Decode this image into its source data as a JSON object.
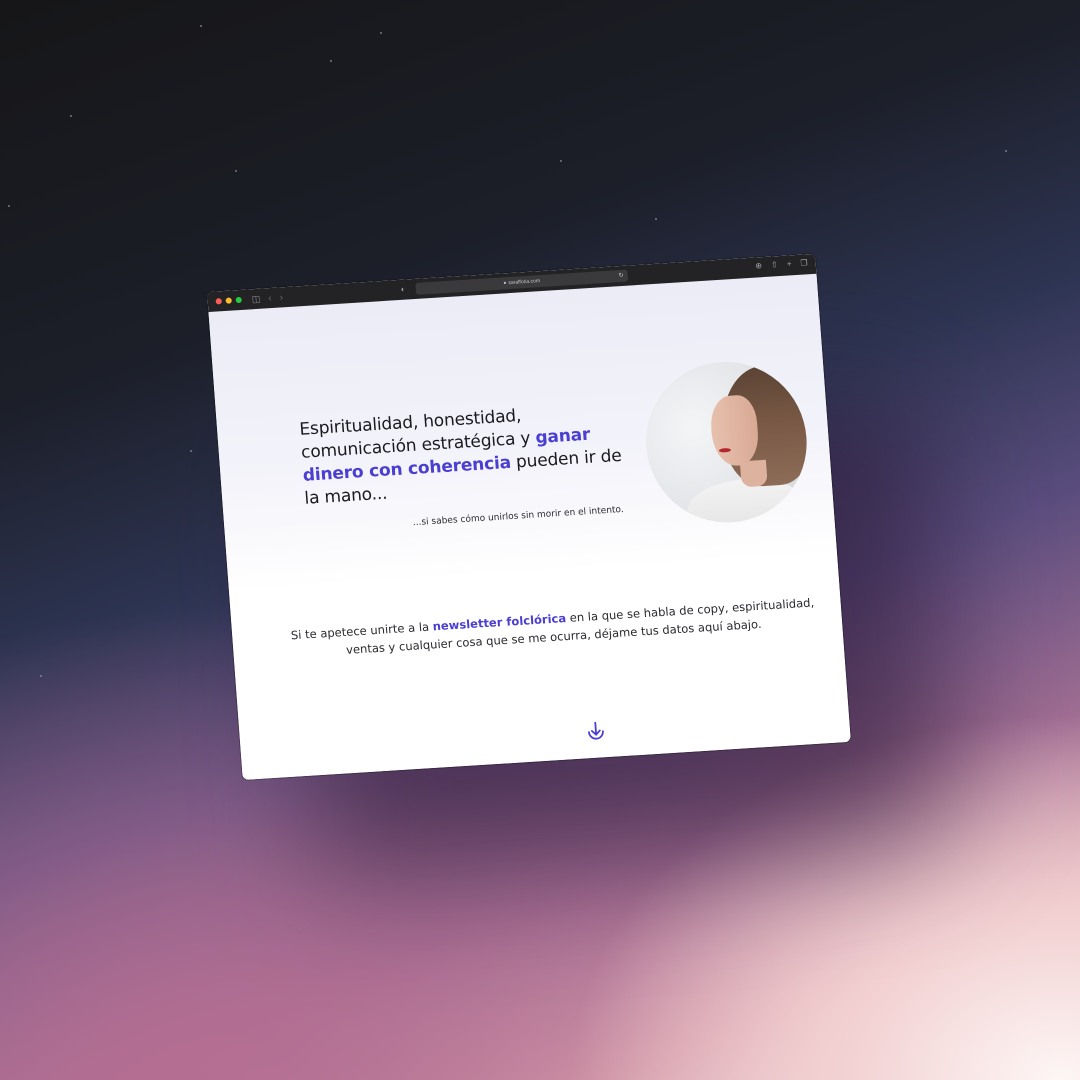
{
  "browser": {
    "url": "sarafforia.com",
    "back_icon": "chevron-left-icon",
    "forward_icon": "chevron-right-icon",
    "sidebar_icon": "sidebar-icon",
    "shield_icon": "shield-icon",
    "reload_icon": "reload-icon",
    "right_icons": [
      "download-icon",
      "share-icon",
      "plus-icon",
      "tabs-icon"
    ]
  },
  "hero": {
    "headline_part1": "Espiritualidad, honestidad, comunicación estratégica y ",
    "headline_accent": "ganar dinero con coherencia",
    "headline_part2": " pueden ir de la mano...",
    "subtag": "...si sabes cómo unirlos sin morir en el intento."
  },
  "newsletter": {
    "text_before": "Si te apetece unirte a la ",
    "link": "newsletter folclórica",
    "text_after": " en la que se habla de copy, espiritualidad, ventas y cualquier cosa que se me ocurra, déjame tus datos aquí abajo."
  },
  "scroll": {
    "icon": "arrow-down-circle-icon"
  },
  "colors": {
    "accent": "#4b3fd1",
    "titlebar": "#232325"
  }
}
